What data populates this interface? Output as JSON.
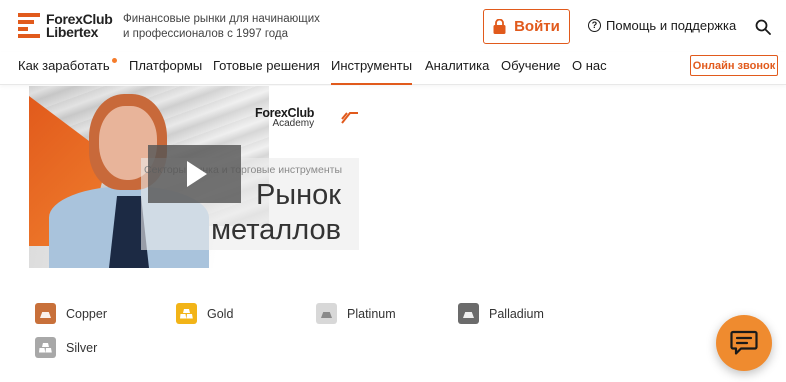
{
  "header": {
    "logo": {
      "line1": "ForexClub",
      "line2": "Libertex",
      "brand_color": "#e15a1c"
    },
    "tagline": "Финансовые рынки для начинающих и профессионалов с 1997 года",
    "login_label": "Войти",
    "help_label": "Помощь и поддержка",
    "icons": {
      "login": "lock-icon",
      "help": "question-circle-icon",
      "search": "search-icon"
    }
  },
  "nav": {
    "items": [
      {
        "label": "Как заработать",
        "has_dot": true
      },
      {
        "label": "Платформы"
      },
      {
        "label": "Готовые решения"
      },
      {
        "label": "Инструменты",
        "active": true
      },
      {
        "label": "Аналитика"
      },
      {
        "label": "Обучение"
      },
      {
        "label": "О нас"
      }
    ],
    "callback_label": "Онлайн звонок"
  },
  "video": {
    "academy_title": "ForexClub",
    "academy_sub": "Academy",
    "caption_sub": "Секторы рынка и торговые инструменты",
    "caption_line1": "Рынок",
    "caption_line2": "металлов",
    "play_icon": "play-icon"
  },
  "metals": [
    {
      "label": "Copper",
      "color": "#c8703a"
    },
    {
      "label": "Gold",
      "color": "#f2b418"
    },
    {
      "label": "Platinum",
      "color": "#d8d8d8"
    },
    {
      "label": "Palladium",
      "color": "#6b6b6b"
    },
    {
      "label": "Silver",
      "color": "#a8a8a8"
    }
  ],
  "chat": {
    "icon": "chat-icon",
    "color": "#ef8b2f"
  }
}
